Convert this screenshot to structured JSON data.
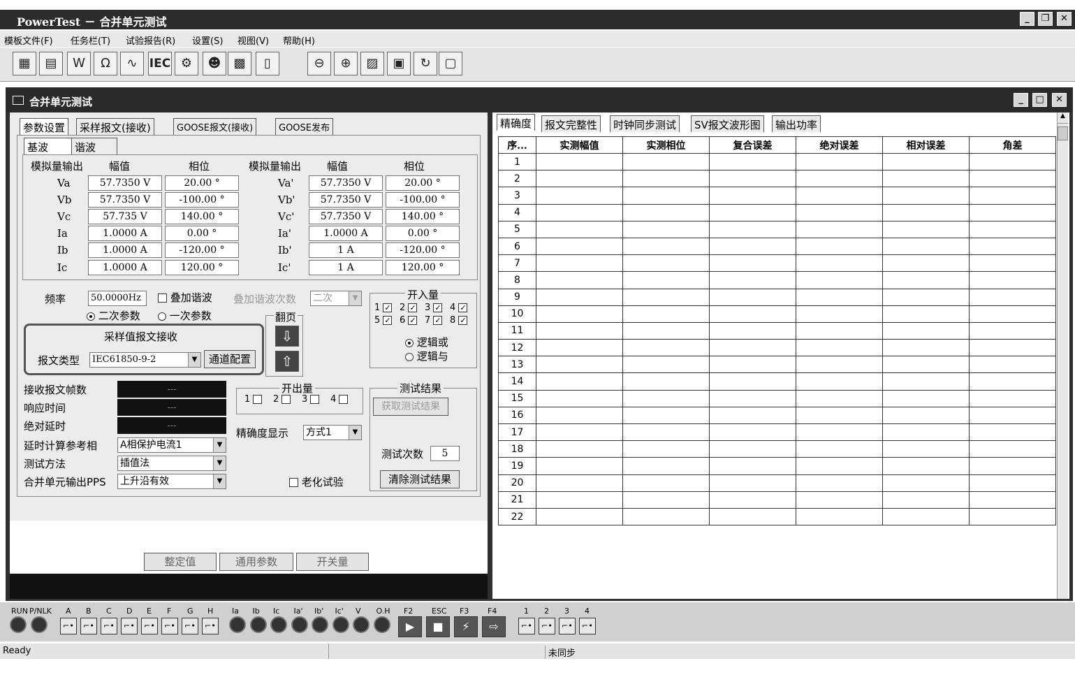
{
  "app": {
    "title": "PowerTest － 合并单元测试"
  },
  "menu": [
    "模板文件(F)",
    "任务栏(T)",
    "试验报告(R)",
    "设置(S)",
    "视图(V)",
    "帮助(H)"
  ],
  "toolbar": {
    "iec_label": "IEC"
  },
  "child": {
    "title": "合并单元测试"
  },
  "left_tabs": [
    "参数设置",
    "采样报文(接收)",
    "GOOSE报文(接收)",
    "GOOSE发布"
  ],
  "sub_tabs": [
    "基波",
    "谐波"
  ],
  "analog": {
    "headers": [
      "模拟量输出",
      "幅值",
      "相位",
      "模拟量输出",
      "幅值",
      "相位"
    ],
    "rows": [
      {
        "n1": "Va",
        "a1": "57.7350 V",
        "p1": "20.00 °",
        "n2": "Va'",
        "a2": "57.7350 V",
        "p2": "20.00 °"
      },
      {
        "n1": "Vb",
        "a1": "57.7350 V",
        "p1": "-100.00 °",
        "n2": "Vb'",
        "a2": "57.7350 V",
        "p2": "-100.00 °"
      },
      {
        "n1": "Vc",
        "a1": "57.735 V",
        "p1": "140.00 °",
        "n2": "Vc'",
        "a2": "57.7350 V",
        "p2": "140.00 °"
      },
      {
        "n1": "Ia",
        "a1": "1.0000 A",
        "p1": "0.00 °",
        "n2": "Ia'",
        "a2": "1.0000 A",
        "p2": "0.00 °"
      },
      {
        "n1": "Ib",
        "a1": "1.0000 A",
        "p1": "-120.00 °",
        "n2": "Ib'",
        "a2": "1 A",
        "p2": "-120.00 °"
      },
      {
        "n1": "Ic",
        "a1": "1.0000 A",
        "p1": "120.00 °",
        "n2": "Ic'",
        "a2": "1 A",
        "p2": "120.00 °"
      }
    ]
  },
  "freq": {
    "label": "频率",
    "value": "50.0000Hz",
    "harm_label": "叠加谐波",
    "harm_order_label": "叠加谐波次数",
    "harm_order": "二次",
    "secondary": "二次参数",
    "primary": "一次参数"
  },
  "sample": {
    "group": "采样值报文接收",
    "type_label": "报文类型",
    "type_value": "IEC61850-9-2",
    "channel_btn": "通道配置"
  },
  "page": {
    "label": "翻页"
  },
  "binary_in": {
    "label": "开入量",
    "logic_or": "逻辑或",
    "logic_and": "逻辑与",
    "items": [
      "1",
      "2",
      "3",
      "4",
      "5",
      "6",
      "7",
      "8"
    ]
  },
  "binary_out": {
    "label": "开出量",
    "items": [
      "1",
      "2",
      "3",
      "4"
    ]
  },
  "stats": {
    "frames": "接收报文帧数",
    "response": "响应时间",
    "delay": "绝对延时",
    "dash": "---"
  },
  "delay_ref": {
    "label": "延时计算参考相",
    "value": "A相保护电流1"
  },
  "method": {
    "label": "测试方法",
    "value": "插值法"
  },
  "pps": {
    "label": "合并单元输出PPS",
    "value": "上升沿有效"
  },
  "precision": {
    "label": "精确度显示",
    "value": "方式1"
  },
  "aging": "老化试验",
  "result": {
    "label": "测试结果",
    "get_btn": "获取测试结果",
    "count_label": "测试次数",
    "count": "5",
    "clear_btn": "清除测试结果"
  },
  "bottom_btns": [
    "整定值",
    "通用参数",
    "开关量"
  ],
  "right_tabs": [
    "精确度",
    "报文完整性",
    "时钟同步测试",
    "SV报文波形图",
    "输出功率"
  ],
  "grid": {
    "headers": [
      "序...",
      "实测幅值",
      "实测相位",
      "复合误差",
      "绝对误差",
      "相对误差",
      "角差"
    ],
    "rows": [
      "1",
      "2",
      "3",
      "4",
      "5",
      "6",
      "7",
      "8",
      "9",
      "10",
      "11",
      "12",
      "13",
      "14",
      "15",
      "16",
      "17",
      "18",
      "19",
      "20",
      "21",
      "22"
    ]
  },
  "indicators": {
    "run": "RUN",
    "pnlk": "P/NLK",
    "sw_labels": [
      "A",
      "B",
      "C",
      "D",
      "E",
      "F",
      "G",
      "H"
    ],
    "leds": [
      "Ia",
      "Ib",
      "Ic",
      "Ia'",
      "Ib'",
      "Ic'",
      "V",
      "O.H"
    ],
    "fkeys": [
      "F2",
      "ESC",
      "F3",
      "F4"
    ],
    "out_labels": [
      "1",
      "2",
      "3",
      "4"
    ]
  },
  "status": {
    "left": "Ready",
    "sync": "未同步"
  }
}
